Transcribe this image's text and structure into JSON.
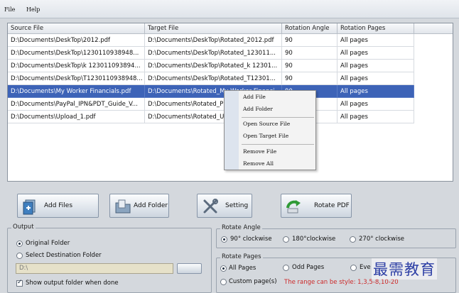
{
  "menu": {
    "items": [
      "File",
      "Help"
    ]
  },
  "table": {
    "headers": [
      "Source File",
      "Target File",
      "Rotation Angle",
      "Rotation Pages"
    ],
    "rows": [
      [
        "D:\\Documents\\DeskTop\\2012.pdf",
        "D:\\Documents\\DeskTop\\Rotated_2012.pdf",
        "90",
        "All pages"
      ],
      [
        "D:\\Documents\\DeskTop\\1230110938948...",
        "D:\\Documents\\DeskTop\\Rotated_123011...",
        "90",
        "All pages"
      ],
      [
        "D:\\Documents\\DeskTop\\k 123011093894...",
        "D:\\Documents\\DeskTop\\Rotated_k 12301...",
        "90",
        "All pages"
      ],
      [
        "D:\\Documents\\DeskTop\\T1230110938948...",
        "D:\\Documents\\DeskTop\\Rotated_T12301...",
        "90",
        "All pages"
      ],
      [
        "D:\\Documents\\My Worker Financials.pdf",
        "D:\\Documents\\Rotated_My Worker Financi...",
        "90",
        "All pages"
      ],
      [
        "D:\\Documents\\PayPal_IPN&PDT_Guide_V...",
        "D:\\Documents\\Rotated_P",
        "",
        "All pages"
      ],
      [
        "D:\\Documents\\Upload_1.pdf",
        "D:\\Documents\\Rotated_U",
        "",
        "All pages"
      ]
    ],
    "selected_index": 4
  },
  "context_menu": {
    "add_file": "Add File",
    "add_folder": "Add Folder",
    "open_source": "Open Source File",
    "open_target": "Open Target File",
    "remove_file": "Remove File",
    "remove_all": "Remove All"
  },
  "toolbar": {
    "add_files": "Add Files",
    "add_folder": "Add Folder",
    "setting": "Setting",
    "rotate_pdf": "Rotate PDF"
  },
  "output": {
    "legend": "Output",
    "original_folder": "Original Folder",
    "select_destination": "Select Destination Folder",
    "path_value": "D:\\",
    "show_output": "Show output folder when done",
    "selected": "original",
    "show_checked": true
  },
  "rotate_angle": {
    "legend": "Rotate Angle",
    "options": [
      "90° clockwise",
      "180°clockwise",
      "270° clockwise"
    ],
    "selected": 0
  },
  "rotate_pages": {
    "legend": "Rotate Pages",
    "all": "All Pages",
    "odd": "Odd Pages",
    "even": "Eve",
    "custom": "Custom page(s)",
    "hint": "The range can be style:  1,3,5-8,10-20",
    "selected": "all"
  },
  "watermark": "最需教育",
  "colors": {
    "selection": "#3d63b7",
    "hint_red": "#cc2a2a",
    "watermark_blue": "#2d3fa5"
  }
}
